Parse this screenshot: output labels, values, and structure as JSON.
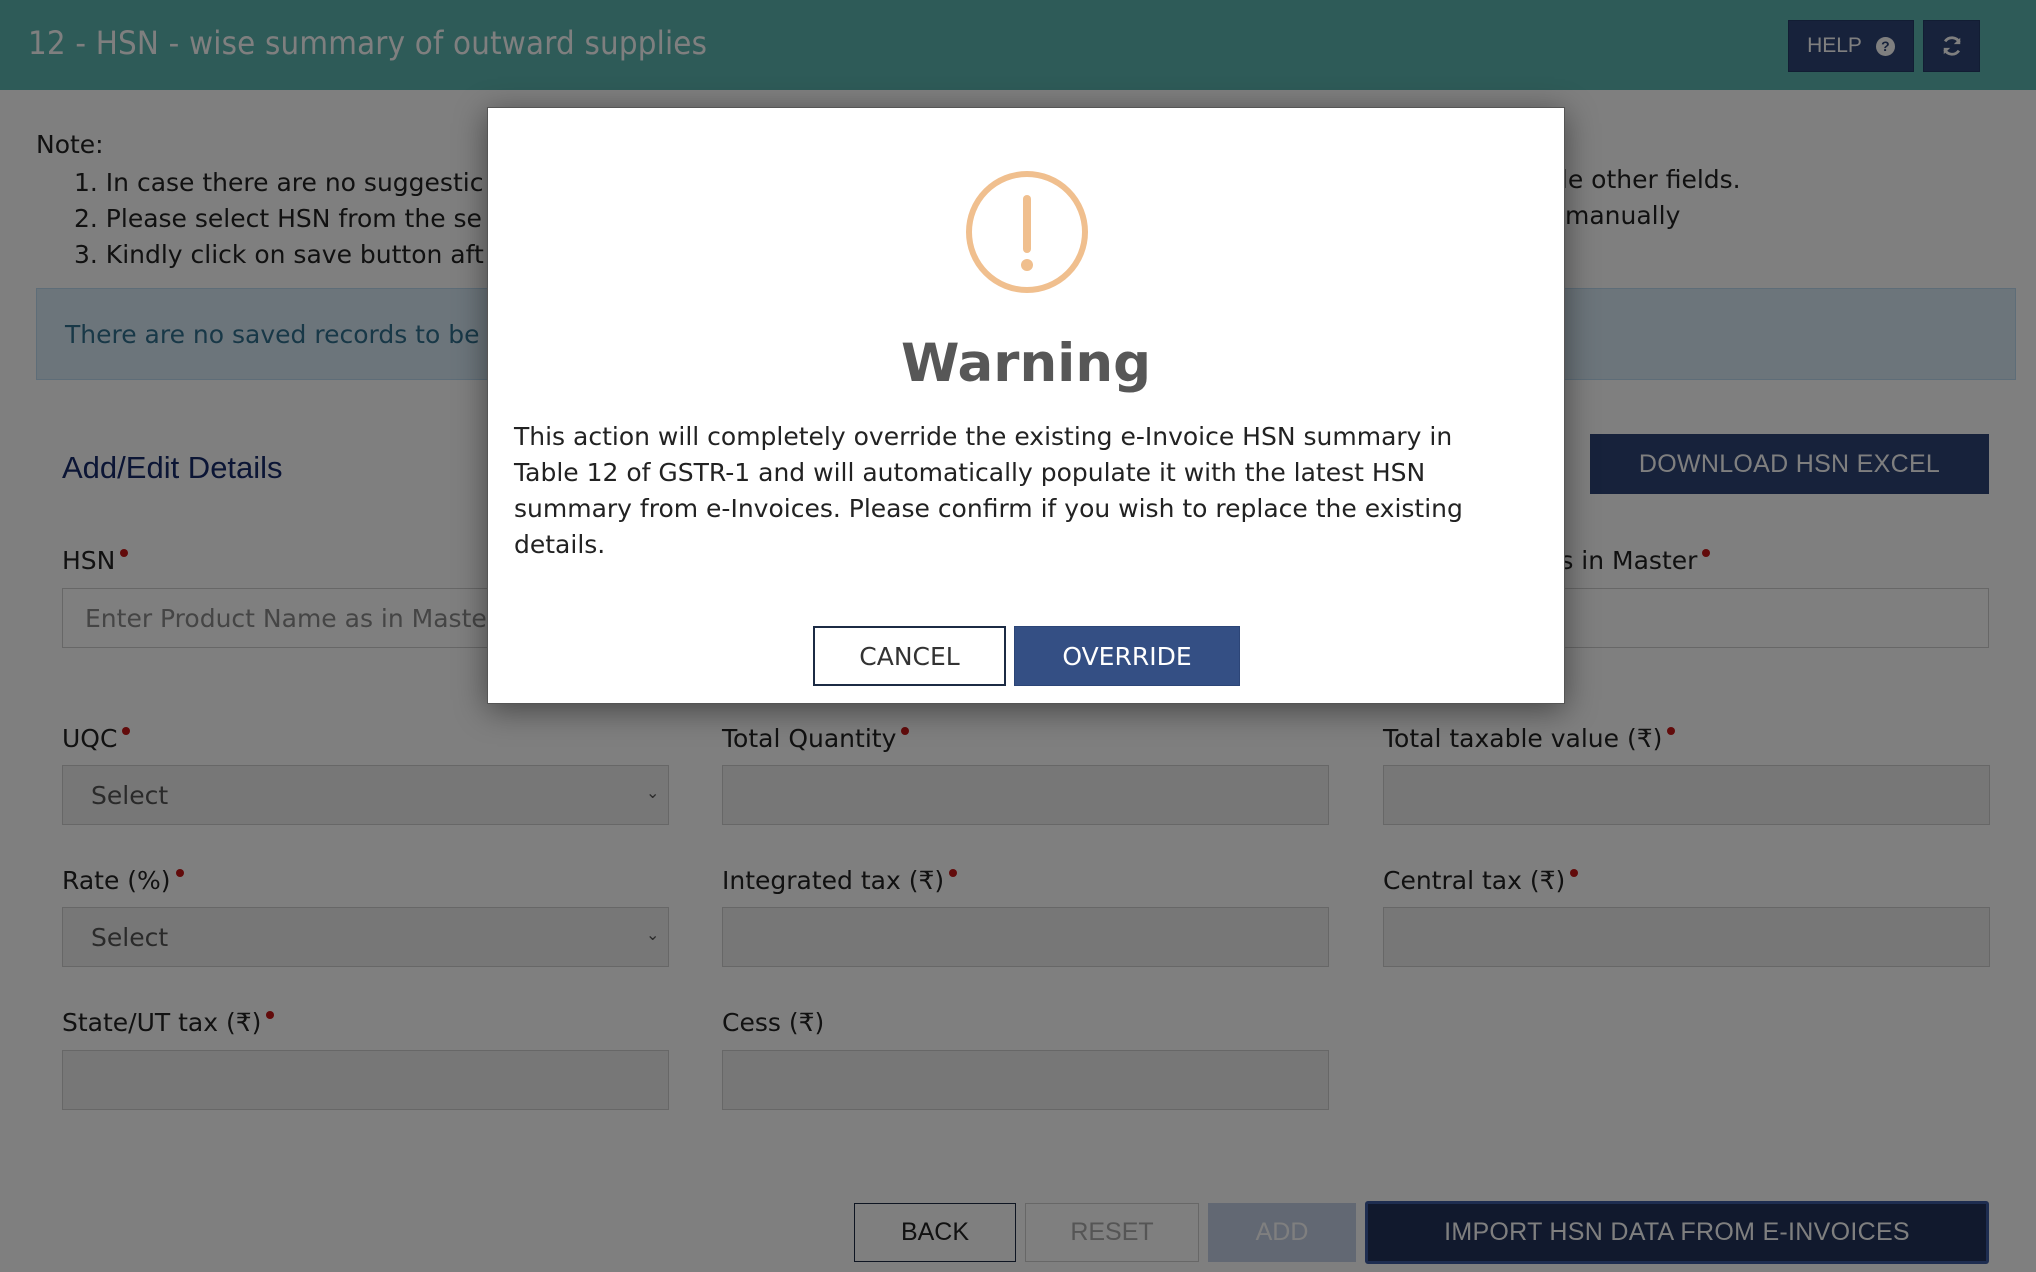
{
  "header": {
    "title": "12 - HSN - wise summary of outward supplies",
    "help_label": "HELP",
    "help_icon": "question-circle-icon",
    "refresh_icon": "refresh-icon"
  },
  "notes": {
    "heading": "Note:",
    "items": [
      "1. In case there are no suggestic",
      "2. Please select HSN from the se",
      "3. Kindly click on save button aft"
    ],
    "items_right_fragments": [
      "ble other fields.",
      " manually"
    ]
  },
  "info_message": "There are no saved records to be",
  "form": {
    "section_title": "Add/Edit Details",
    "download_button": "DOWNLOAD HSN EXCEL",
    "fields": {
      "hsn": {
        "label": "HSN",
        "placeholder": "Enter Product Name as in Master",
        "required": true
      },
      "description": {
        "label_fragment": "as in Master",
        "required": true
      },
      "uqc": {
        "label": "UQC",
        "value": "Select",
        "required": true
      },
      "total_quantity": {
        "label": "Total Quantity",
        "required": true
      },
      "total_taxable_value": {
        "label": "Total taxable value (₹)",
        "required": true
      },
      "rate": {
        "label": "Rate (%)",
        "value": "Select",
        "required": true
      },
      "integrated_tax": {
        "label": "Integrated tax (₹)",
        "required": true
      },
      "central_tax": {
        "label": "Central tax (₹)",
        "required": true
      },
      "state_ut_tax": {
        "label": "State/UT tax (₹)",
        "required": true
      },
      "cess": {
        "label": "Cess (₹)",
        "required": false
      }
    },
    "buttons": {
      "back": "BACK",
      "reset": "RESET",
      "add": "ADD",
      "import": "IMPORT HSN DATA FROM E-INVOICES"
    }
  },
  "modal": {
    "icon": "warning-exclamation-icon",
    "icon_color": "#f0bf8e",
    "title": "Warning",
    "message": "This action will completely override the existing e-Invoice HSN summary in Table 12 of GSTR-1 and will automatically populate it with the latest HSN summary from e-Invoices. Please confirm if you wish to replace the existing details.",
    "cancel_label": "CANCEL",
    "override_label": "OVERRIDE"
  },
  "colors": {
    "header_bg": "#5cb7b1",
    "primary_button": "#2f4577",
    "override_button": "#344f84",
    "required_dot": "#c41616",
    "info_bg": "#d9eaf7",
    "info_text": "#31708f"
  }
}
